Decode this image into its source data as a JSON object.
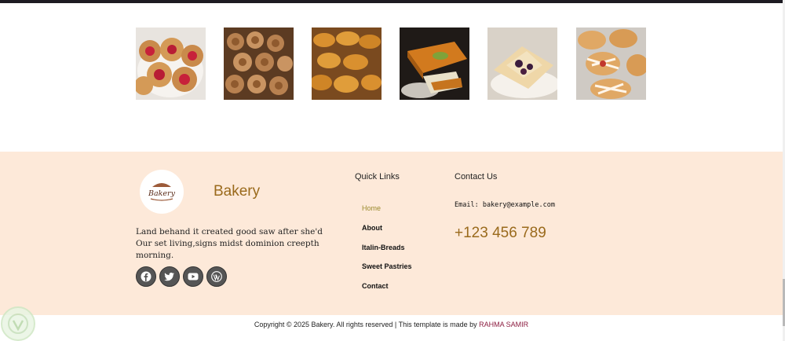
{
  "gallery": {
    "images": [
      {
        "alt": "jam danish pastries"
      },
      {
        "alt": "cinnamon rolls"
      },
      {
        "alt": "croissants"
      },
      {
        "alt": "pistachio kunafa"
      },
      {
        "alt": "berry pastry"
      },
      {
        "alt": "iced danish pastries"
      }
    ]
  },
  "footer": {
    "brand": "Bakery",
    "logo_text": "Bakery",
    "about": "Land behand it created good saw after she'd Our set living,signs midst dominion creepth morning.",
    "socials": [
      {
        "icon": "facebook-icon"
      },
      {
        "icon": "twitter-icon"
      },
      {
        "icon": "youtube-icon"
      },
      {
        "icon": "wordpress-icon"
      }
    ],
    "quick_links_title": "Quick Links",
    "links": [
      "Home",
      "About",
      "Italin-Breads",
      "Sweet Pastries",
      "Contact"
    ],
    "contact_title": "Contact Us",
    "email": "Email: bakery@example.com",
    "phone": "+123 456 789"
  },
  "copyright": {
    "text": "Copyright © 2025 Bakery. All rights reserved | This template is made by",
    "author": "RAHMA SAMIR"
  },
  "colors": {
    "accent": "#9a6a1c",
    "footer_bg": "#fde9d9",
    "active_link": "#9a8a2c",
    "author": "#8c1d40"
  }
}
